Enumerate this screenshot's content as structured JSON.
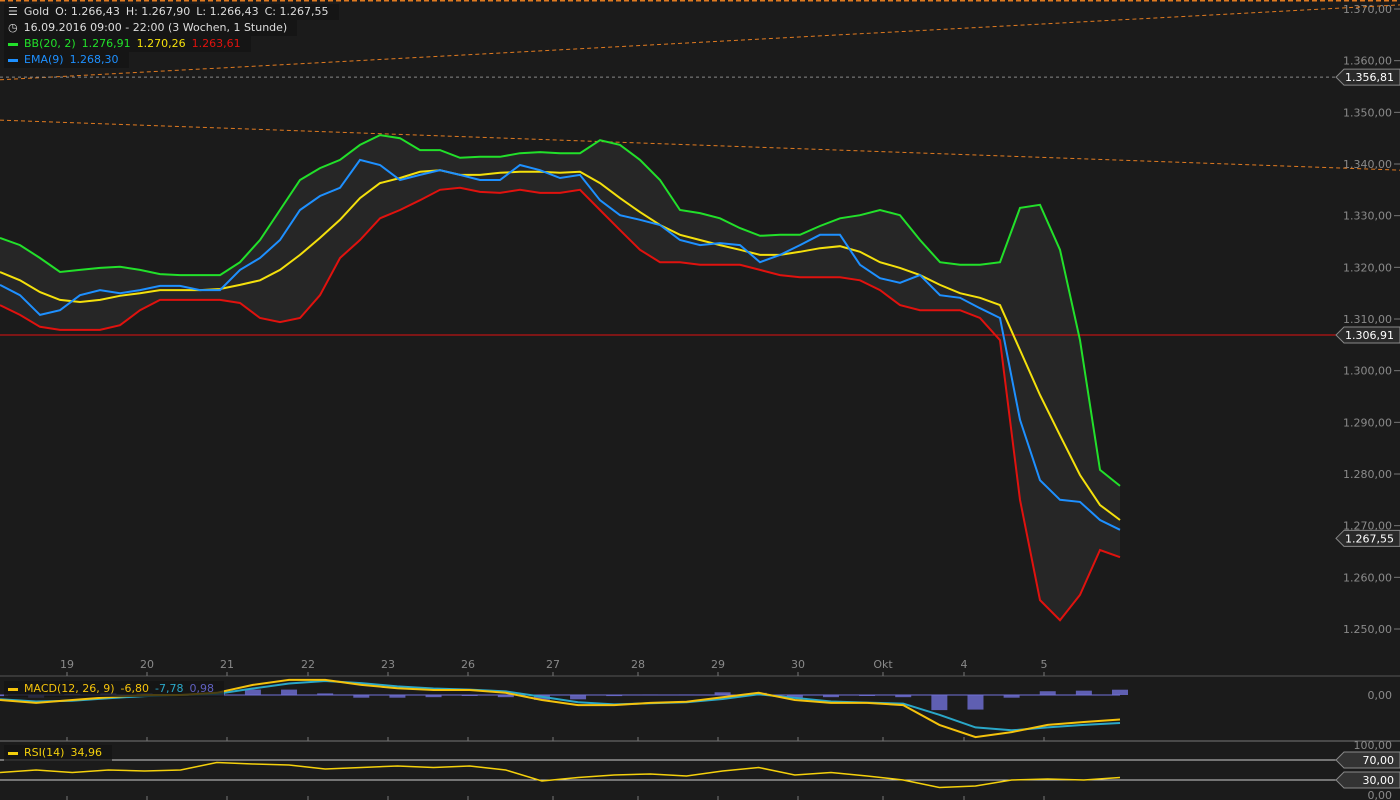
{
  "header": {
    "symbol": "Gold",
    "open": "O: 1.266,43",
    "high": "H: 1.267,90",
    "low": "L: 1.266,43",
    "close": "C: 1.267,55",
    "period": "16.09.2016 09:00 - 22:00 (3 Wochen, 1 Stunde)"
  },
  "indicators": {
    "bb": {
      "label": "BB(20, 2)",
      "upper": "1.276,91",
      "mid": "1.270,26",
      "lower": "1.263,61"
    },
    "ema": {
      "label": "EMA(9)",
      "value": "1.268,30"
    },
    "macd": {
      "label": "MACD(12, 26, 9)",
      "macd": "-6,80",
      "signal": "-7,78",
      "hist": "0,98"
    },
    "rsi": {
      "label": "RSI(14)",
      "value": "34,96"
    }
  },
  "colors": {
    "bg": "#1b1b1b",
    "upper": "#22e02a",
    "mid": "#f4e00c",
    "lower": "#e0120e",
    "ema": "#1e90ff",
    "hline": "#e01010",
    "trend": "#e07a20",
    "macd": "#f4c20c",
    "signal": "#2aa7c8",
    "hist": "#7070d8",
    "rsi": "#f4d00c"
  },
  "chart_data": [
    {
      "type": "line",
      "title": "Gold",
      "ylim": [
        1245,
        1372
      ],
      "x_ticks": [
        "19",
        "20",
        "21",
        "22",
        "23",
        "26",
        "27",
        "28",
        "29",
        "30",
        "Okt",
        "4",
        "5"
      ],
      "y_ticks": [
        "1.370,00",
        "1.360,00",
        "1.350,00",
        "1.340,00",
        "1.330,00",
        "1.320,00",
        "1.310,00",
        "1.300,00",
        "1.290,00",
        "1.280,00",
        "1.270,00",
        "1.260,00",
        "1.250,00"
      ],
      "price_tags": [
        "1.356,81",
        "1.306,91",
        "1.267,55"
      ],
      "horizontal_lines": [
        {
          "price": 1306.91,
          "style": "solid-red"
        },
        {
          "price": 1356.81,
          "style": "dashed-grey"
        }
      ],
      "trendlines": [
        {
          "from": 1356.3,
          "to": 1370.8
        },
        {
          "from": 1348.5,
          "to": 1338.8
        }
      ],
      "series": [
        {
          "name": "BB upper",
          "values": [
            1325.7,
            1324.3,
            1321.8,
            1319.1,
            1319.5,
            1319.9,
            1320.1,
            1319.5,
            1318.7,
            1318.5,
            1318.5,
            1318.5,
            1321.0,
            1325.3,
            1331.1,
            1336.9,
            1339.2,
            1340.8,
            1343.7,
            1345.6,
            1345.0,
            1342.7,
            1342.7,
            1341.2,
            1341.4,
            1341.4,
            1342.1,
            1342.3,
            1342.1,
            1342.1,
            1344.6,
            1343.7,
            1340.8,
            1336.9,
            1331.1,
            1330.5,
            1329.5,
            1327.6,
            1326.1,
            1326.3,
            1326.3,
            1328.0,
            1329.5,
            1330.1,
            1331.1,
            1330.1,
            1325.3,
            1321.0,
            1320.5,
            1320.5,
            1321.0,
            1331.5,
            1332.1,
            1323.4,
            1305.9,
            1280.8,
            1277.7
          ]
        },
        {
          "name": "BB mid",
          "values": [
            1319.1,
            1317.5,
            1315.2,
            1313.7,
            1313.3,
            1313.7,
            1314.5,
            1315.0,
            1315.6,
            1315.6,
            1315.6,
            1315.8,
            1316.6,
            1317.5,
            1319.5,
            1322.4,
            1325.7,
            1329.2,
            1333.4,
            1336.3,
            1337.3,
            1338.5,
            1338.8,
            1337.9,
            1337.9,
            1338.3,
            1338.5,
            1338.5,
            1338.3,
            1338.5,
            1336.3,
            1333.4,
            1330.7,
            1328.2,
            1326.3,
            1325.3,
            1324.3,
            1323.4,
            1322.4,
            1322.4,
            1323.0,
            1323.7,
            1324.1,
            1323.0,
            1321.0,
            1319.9,
            1318.5,
            1316.6,
            1315.0,
            1314.1,
            1312.7,
            1304.0,
            1295.3,
            1287.5,
            1279.8,
            1274.0,
            1271.1
          ]
        },
        {
          "name": "BB lower",
          "values": [
            1312.7,
            1310.8,
            1308.5,
            1307.9,
            1307.9,
            1307.9,
            1308.8,
            1311.7,
            1313.7,
            1313.7,
            1313.7,
            1313.7,
            1313.1,
            1310.2,
            1309.4,
            1310.2,
            1314.6,
            1321.8,
            1325.3,
            1329.5,
            1331.1,
            1333.0,
            1335.0,
            1335.4,
            1334.6,
            1334.4,
            1335.0,
            1334.4,
            1334.4,
            1335.0,
            1331.1,
            1327.2,
            1323.4,
            1321.0,
            1321.0,
            1320.5,
            1320.5,
            1320.5,
            1319.5,
            1318.5,
            1318.1,
            1318.1,
            1318.1,
            1317.5,
            1315.6,
            1312.7,
            1311.7,
            1311.7,
            1311.7,
            1310.2,
            1305.9,
            1275.0,
            1255.6,
            1251.7,
            1256.6,
            1265.3,
            1263.9
          ]
        },
        {
          "name": "EMA(9)",
          "values": [
            1316.6,
            1314.6,
            1310.8,
            1311.7,
            1314.6,
            1315.6,
            1315.0,
            1315.6,
            1316.4,
            1316.4,
            1315.6,
            1315.6,
            1319.5,
            1321.8,
            1325.3,
            1331.1,
            1333.8,
            1335.4,
            1340.8,
            1339.8,
            1336.9,
            1337.9,
            1338.8,
            1337.9,
            1336.9,
            1336.9,
            1339.8,
            1338.8,
            1337.3,
            1337.9,
            1333.0,
            1330.1,
            1329.2,
            1328.2,
            1325.3,
            1324.3,
            1324.7,
            1324.3,
            1321.0,
            1322.4,
            1324.3,
            1326.3,
            1326.3,
            1320.5,
            1317.9,
            1317.0,
            1318.5,
            1314.6,
            1314.1,
            1312.1,
            1310.2,
            1290.5,
            1278.8,
            1275.0,
            1274.6,
            1271.1,
            1269.2
          ]
        }
      ]
    },
    {
      "type": "line",
      "title": "MACD(12, 26, 9)",
      "y_ticks": [
        "0,00"
      ],
      "series": [
        {
          "name": "MACD",
          "values": [
            -1.4,
            -2.2,
            -1.4,
            -0.6,
            0,
            0,
            0.6,
            2.8,
            4.2,
            4.2,
            2.8,
            1.9,
            1.4,
            1.4,
            0.6,
            -1.4,
            -2.8,
            -2.8,
            -2.2,
            -1.9,
            -0.6,
            0.6,
            -1.4,
            -2.2,
            -2.2,
            -2.8,
            -8.3,
            -11.7,
            -10.3,
            -8.3,
            -7.5,
            -6.8
          ]
        },
        {
          "name": "Signal",
          "values": [
            -1.2,
            -1.8,
            -1.6,
            -0.9,
            -0.3,
            0,
            0.3,
            1.8,
            3.2,
            3.9,
            3.3,
            2.4,
            1.8,
            1.5,
            1.0,
            -0.5,
            -2.0,
            -2.6,
            -2.3,
            -2.0,
            -1.1,
            0.2,
            -0.8,
            -1.8,
            -2.1,
            -2.4,
            -5.5,
            -9.0,
            -9.8,
            -9.0,
            -8.3,
            -7.78
          ]
        }
      ]
    },
    {
      "type": "line",
      "title": "RSI(14)",
      "ylim": [
        0,
        100
      ],
      "y_ticks": [
        "100,00",
        "0,00"
      ],
      "levels": [
        "70,00",
        "30,00"
      ],
      "series": [
        {
          "name": "RSI",
          "values": [
            45,
            50,
            45,
            50,
            48,
            50,
            65,
            62,
            60,
            52,
            55,
            58,
            55,
            58,
            50,
            28,
            35,
            40,
            42,
            38,
            48,
            55,
            40,
            45,
            38,
            30,
            15,
            18,
            30,
            32,
            30,
            35
          ]
        }
      ]
    }
  ]
}
